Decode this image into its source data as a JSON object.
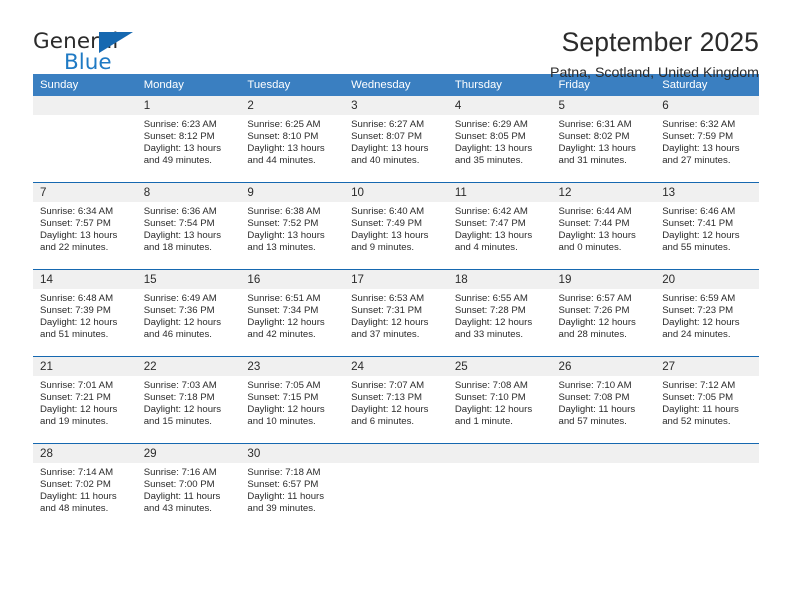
{
  "brand": {
    "name_top": "General",
    "name_bottom": "Blue",
    "flag_icon": "triangle-flag-icon",
    "accent_color": "#1668b0",
    "header_color": "#3a7fc1"
  },
  "header": {
    "title": "September 2025",
    "subtitle": "Patna, Scotland, United Kingdom"
  },
  "weekday_headers": [
    "Sunday",
    "Monday",
    "Tuesday",
    "Wednesday",
    "Thursday",
    "Friday",
    "Saturday"
  ],
  "labels": {
    "sunrise": "Sunrise:",
    "sunset": "Sunset:",
    "daylight": "Daylight:"
  },
  "weeks": [
    [
      {
        "day": "",
        "sunrise": "",
        "sunset": "",
        "daylight_a": "",
        "daylight_b": ""
      },
      {
        "day": "1",
        "sunrise": "Sunrise: 6:23 AM",
        "sunset": "Sunset: 8:12 PM",
        "daylight_a": "Daylight: 13 hours",
        "daylight_b": "and 49 minutes."
      },
      {
        "day": "2",
        "sunrise": "Sunrise: 6:25 AM",
        "sunset": "Sunset: 8:10 PM",
        "daylight_a": "Daylight: 13 hours",
        "daylight_b": "and 44 minutes."
      },
      {
        "day": "3",
        "sunrise": "Sunrise: 6:27 AM",
        "sunset": "Sunset: 8:07 PM",
        "daylight_a": "Daylight: 13 hours",
        "daylight_b": "and 40 minutes."
      },
      {
        "day": "4",
        "sunrise": "Sunrise: 6:29 AM",
        "sunset": "Sunset: 8:05 PM",
        "daylight_a": "Daylight: 13 hours",
        "daylight_b": "and 35 minutes."
      },
      {
        "day": "5",
        "sunrise": "Sunrise: 6:31 AM",
        "sunset": "Sunset: 8:02 PM",
        "daylight_a": "Daylight: 13 hours",
        "daylight_b": "and 31 minutes."
      },
      {
        "day": "6",
        "sunrise": "Sunrise: 6:32 AM",
        "sunset": "Sunset: 7:59 PM",
        "daylight_a": "Daylight: 13 hours",
        "daylight_b": "and 27 minutes."
      }
    ],
    [
      {
        "day": "7",
        "sunrise": "Sunrise: 6:34 AM",
        "sunset": "Sunset: 7:57 PM",
        "daylight_a": "Daylight: 13 hours",
        "daylight_b": "and 22 minutes."
      },
      {
        "day": "8",
        "sunrise": "Sunrise: 6:36 AM",
        "sunset": "Sunset: 7:54 PM",
        "daylight_a": "Daylight: 13 hours",
        "daylight_b": "and 18 minutes."
      },
      {
        "day": "9",
        "sunrise": "Sunrise: 6:38 AM",
        "sunset": "Sunset: 7:52 PM",
        "daylight_a": "Daylight: 13 hours",
        "daylight_b": "and 13 minutes."
      },
      {
        "day": "10",
        "sunrise": "Sunrise: 6:40 AM",
        "sunset": "Sunset: 7:49 PM",
        "daylight_a": "Daylight: 13 hours",
        "daylight_b": "and 9 minutes."
      },
      {
        "day": "11",
        "sunrise": "Sunrise: 6:42 AM",
        "sunset": "Sunset: 7:47 PM",
        "daylight_a": "Daylight: 13 hours",
        "daylight_b": "and 4 minutes."
      },
      {
        "day": "12",
        "sunrise": "Sunrise: 6:44 AM",
        "sunset": "Sunset: 7:44 PM",
        "daylight_a": "Daylight: 13 hours",
        "daylight_b": "and 0 minutes."
      },
      {
        "day": "13",
        "sunrise": "Sunrise: 6:46 AM",
        "sunset": "Sunset: 7:41 PM",
        "daylight_a": "Daylight: 12 hours",
        "daylight_b": "and 55 minutes."
      }
    ],
    [
      {
        "day": "14",
        "sunrise": "Sunrise: 6:48 AM",
        "sunset": "Sunset: 7:39 PM",
        "daylight_a": "Daylight: 12 hours",
        "daylight_b": "and 51 minutes."
      },
      {
        "day": "15",
        "sunrise": "Sunrise: 6:49 AM",
        "sunset": "Sunset: 7:36 PM",
        "daylight_a": "Daylight: 12 hours",
        "daylight_b": "and 46 minutes."
      },
      {
        "day": "16",
        "sunrise": "Sunrise: 6:51 AM",
        "sunset": "Sunset: 7:34 PM",
        "daylight_a": "Daylight: 12 hours",
        "daylight_b": "and 42 minutes."
      },
      {
        "day": "17",
        "sunrise": "Sunrise: 6:53 AM",
        "sunset": "Sunset: 7:31 PM",
        "daylight_a": "Daylight: 12 hours",
        "daylight_b": "and 37 minutes."
      },
      {
        "day": "18",
        "sunrise": "Sunrise: 6:55 AM",
        "sunset": "Sunset: 7:28 PM",
        "daylight_a": "Daylight: 12 hours",
        "daylight_b": "and 33 minutes."
      },
      {
        "day": "19",
        "sunrise": "Sunrise: 6:57 AM",
        "sunset": "Sunset: 7:26 PM",
        "daylight_a": "Daylight: 12 hours",
        "daylight_b": "and 28 minutes."
      },
      {
        "day": "20",
        "sunrise": "Sunrise: 6:59 AM",
        "sunset": "Sunset: 7:23 PM",
        "daylight_a": "Daylight: 12 hours",
        "daylight_b": "and 24 minutes."
      }
    ],
    [
      {
        "day": "21",
        "sunrise": "Sunrise: 7:01 AM",
        "sunset": "Sunset: 7:21 PM",
        "daylight_a": "Daylight: 12 hours",
        "daylight_b": "and 19 minutes."
      },
      {
        "day": "22",
        "sunrise": "Sunrise: 7:03 AM",
        "sunset": "Sunset: 7:18 PM",
        "daylight_a": "Daylight: 12 hours",
        "daylight_b": "and 15 minutes."
      },
      {
        "day": "23",
        "sunrise": "Sunrise: 7:05 AM",
        "sunset": "Sunset: 7:15 PM",
        "daylight_a": "Daylight: 12 hours",
        "daylight_b": "and 10 minutes."
      },
      {
        "day": "24",
        "sunrise": "Sunrise: 7:07 AM",
        "sunset": "Sunset: 7:13 PM",
        "daylight_a": "Daylight: 12 hours",
        "daylight_b": "and 6 minutes."
      },
      {
        "day": "25",
        "sunrise": "Sunrise: 7:08 AM",
        "sunset": "Sunset: 7:10 PM",
        "daylight_a": "Daylight: 12 hours",
        "daylight_b": "and 1 minute."
      },
      {
        "day": "26",
        "sunrise": "Sunrise: 7:10 AM",
        "sunset": "Sunset: 7:08 PM",
        "daylight_a": "Daylight: 11 hours",
        "daylight_b": "and 57 minutes."
      },
      {
        "day": "27",
        "sunrise": "Sunrise: 7:12 AM",
        "sunset": "Sunset: 7:05 PM",
        "daylight_a": "Daylight: 11 hours",
        "daylight_b": "and 52 minutes."
      }
    ],
    [
      {
        "day": "28",
        "sunrise": "Sunrise: 7:14 AM",
        "sunset": "Sunset: 7:02 PM",
        "daylight_a": "Daylight: 11 hours",
        "daylight_b": "and 48 minutes."
      },
      {
        "day": "29",
        "sunrise": "Sunrise: 7:16 AM",
        "sunset": "Sunset: 7:00 PM",
        "daylight_a": "Daylight: 11 hours",
        "daylight_b": "and 43 minutes."
      },
      {
        "day": "30",
        "sunrise": "Sunrise: 7:18 AM",
        "sunset": "Sunset: 6:57 PM",
        "daylight_a": "Daylight: 11 hours",
        "daylight_b": "and 39 minutes."
      },
      {
        "day": "",
        "sunrise": "",
        "sunset": "",
        "daylight_a": "",
        "daylight_b": ""
      },
      {
        "day": "",
        "sunrise": "",
        "sunset": "",
        "daylight_a": "",
        "daylight_b": ""
      },
      {
        "day": "",
        "sunrise": "",
        "sunset": "",
        "daylight_a": "",
        "daylight_b": ""
      },
      {
        "day": "",
        "sunrise": "",
        "sunset": "",
        "daylight_a": "",
        "daylight_b": ""
      }
    ]
  ]
}
